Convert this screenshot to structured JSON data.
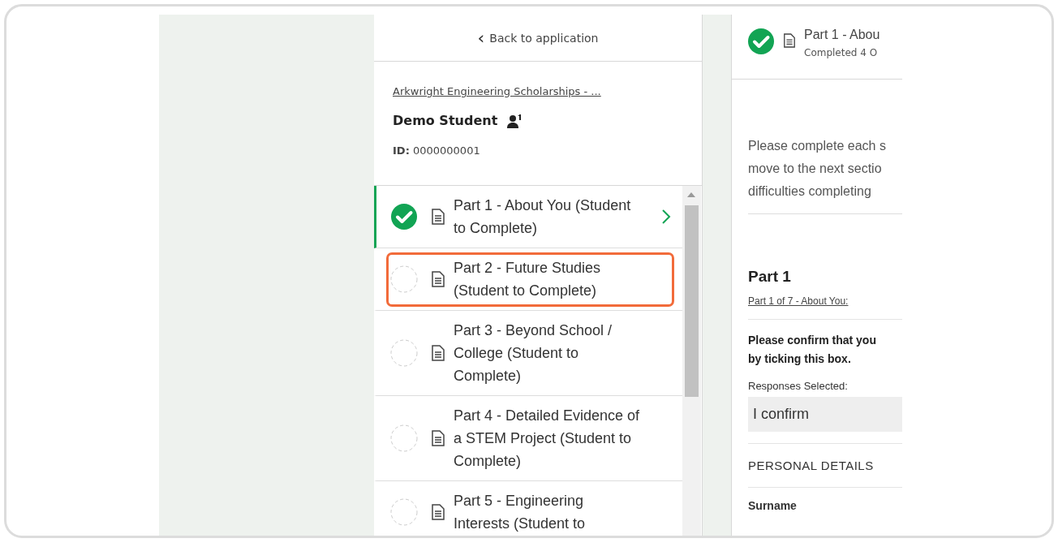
{
  "back_link": {
    "icon": "‹",
    "label": "Back to application"
  },
  "program_link": "Arkwright Engineering Scholarships - ...",
  "student": {
    "name": "Demo Student",
    "id_label": "ID:",
    "id_value": "0000000001"
  },
  "sections": [
    {
      "title": "Part 1 - About You (Student to Complete)",
      "completed": true,
      "selected": true,
      "highlighted": false
    },
    {
      "title": "Part 2 - Future Studies (Student to Complete)",
      "completed": false,
      "selected": false,
      "highlighted": true
    },
    {
      "title": "Part 3 - Beyond School / College (Student to Complete)",
      "completed": false,
      "selected": false,
      "highlighted": false
    },
    {
      "title": "Part 4 - Detailed Evidence of a STEM Project (Student to Complete)",
      "completed": false,
      "selected": false,
      "highlighted": false
    },
    {
      "title": "Part 5 - Engineering Interests (Student to",
      "completed": false,
      "selected": false,
      "highlighted": false
    }
  ],
  "detail": {
    "header": {
      "title": "Part 1 - Abou",
      "subtitle": "Completed 4 O",
      "completed": true
    },
    "intro_lines": [
      "Please complete each s",
      "move to the next sectio",
      "difficulties completing"
    ],
    "part_heading": "Part 1",
    "part_link": "Part 1 of 7 - About You:",
    "question_lines": [
      "Please confirm that you",
      "by ticking this box."
    ],
    "responses_label": "Responses Selected:",
    "response_value": "I confirm",
    "section_heading": "PERSONAL DETAILS",
    "field_label": "Surname"
  }
}
